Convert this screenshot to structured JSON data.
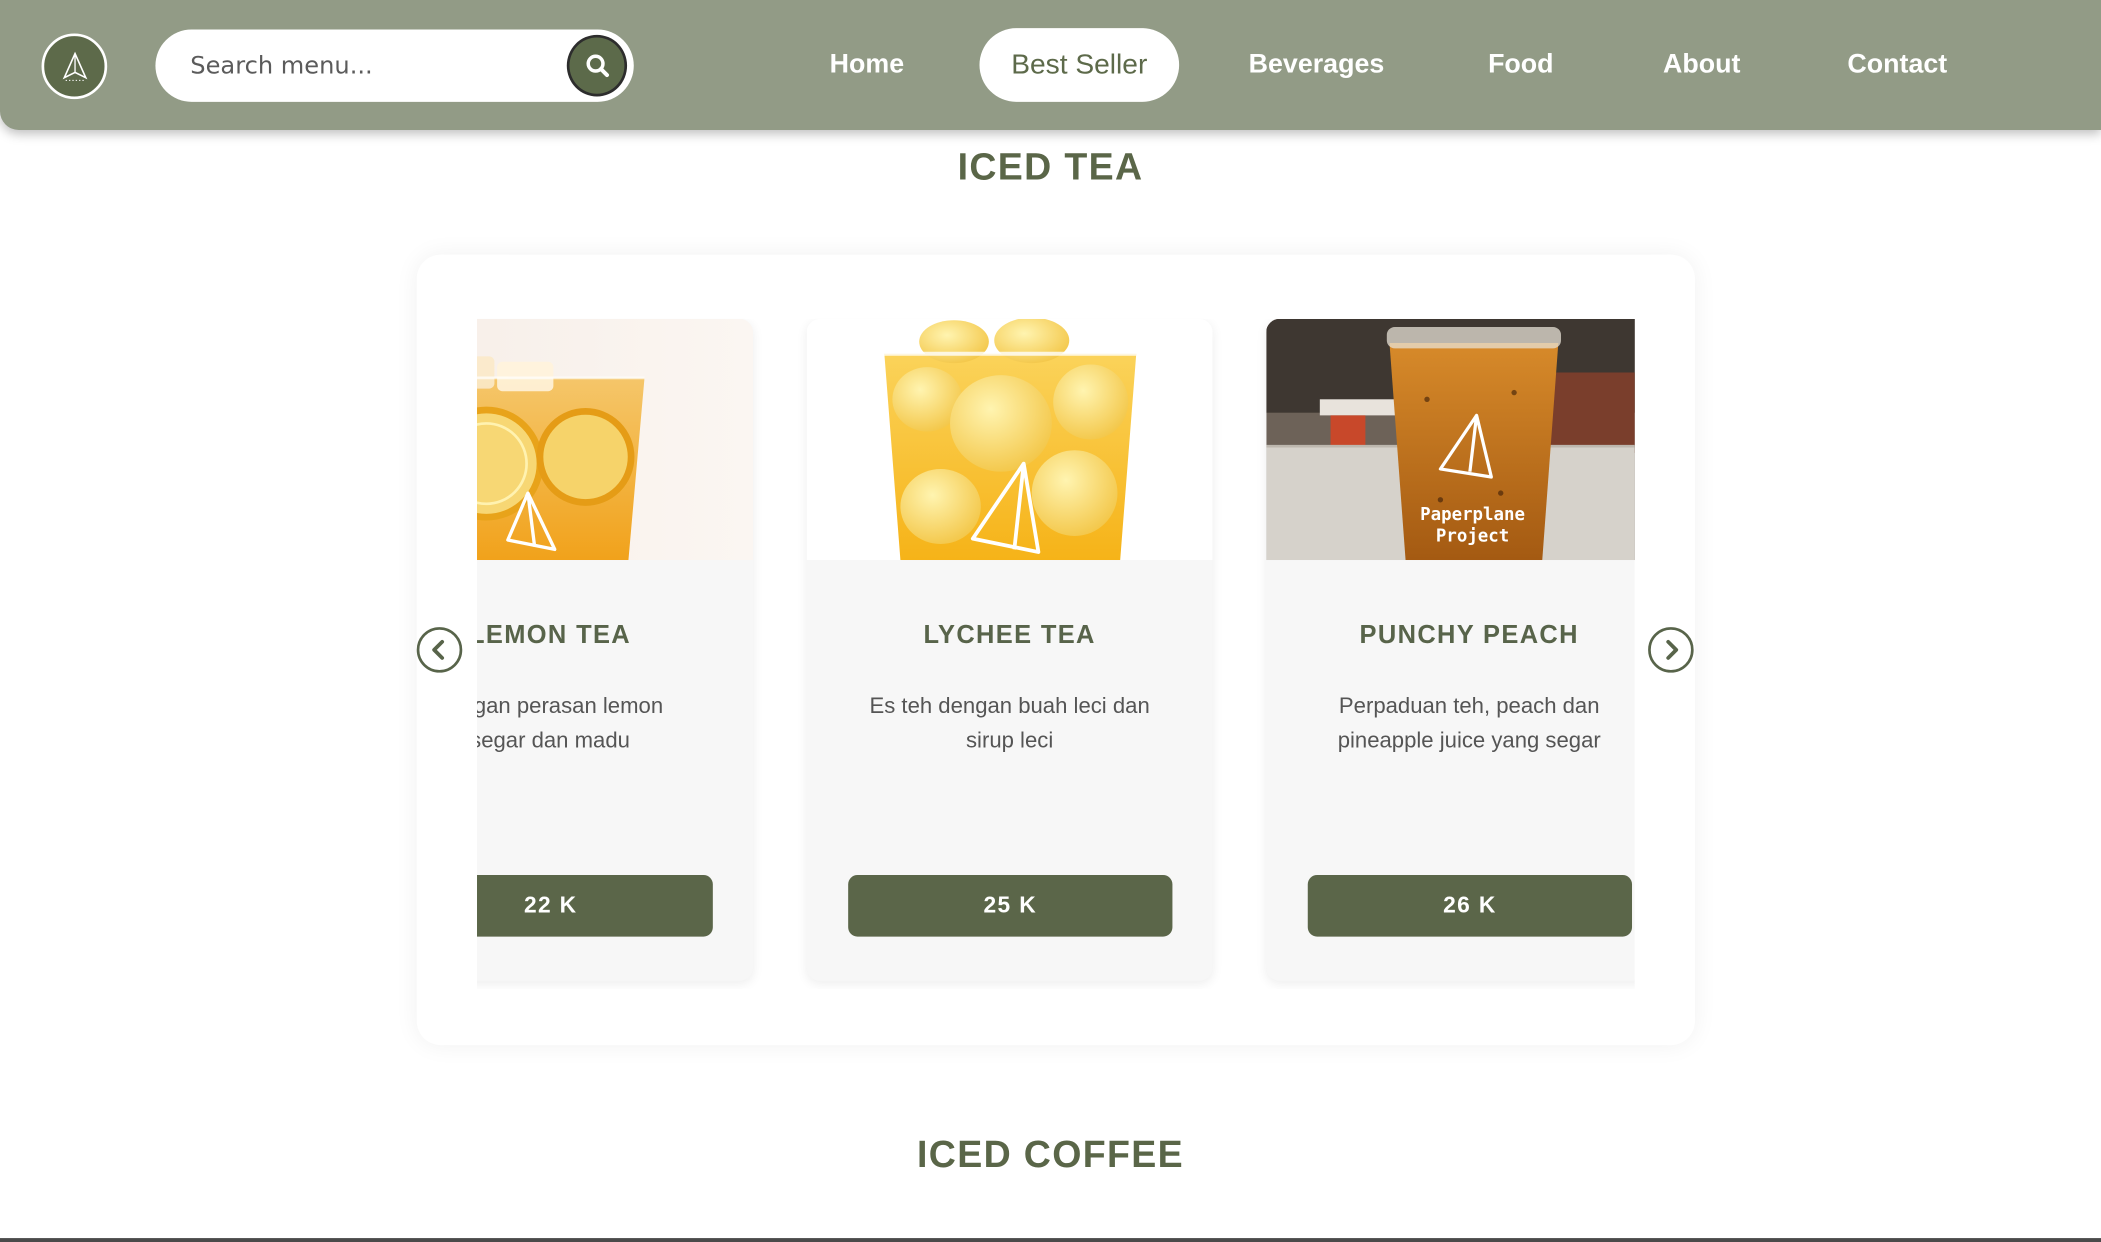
{
  "header": {
    "search_placeholder": "Search menu...",
    "nav": [
      "Home",
      "Best Seller",
      "Beverages",
      "Food",
      "About",
      "Contact"
    ],
    "active_nav": "Best Seller"
  },
  "sections": {
    "iced_tea_title": "ICED TEA",
    "iced_coffee_title": "ICED COFFEE"
  },
  "products": [
    {
      "name": "LEMON TEA",
      "desc_line1": "dengan perasan lemon",
      "desc_line2": "segar dan madu",
      "price": "22 K"
    },
    {
      "name": "LYCHEE TEA",
      "desc_line1": "Es teh dengan buah leci dan",
      "desc_line2": "sirup leci",
      "price": "25 K"
    },
    {
      "name": "PUNCHY PEACH",
      "desc_line1": "Perpaduan teh, peach dan",
      "desc_line2": "pineapple juice yang segar",
      "price": "26 K"
    }
  ],
  "cup_print": [
    "Paperplane",
    "Project"
  ],
  "colors": {
    "header_bg": "#929b86",
    "accent": "#5b6649",
    "title": "#5a6648"
  }
}
